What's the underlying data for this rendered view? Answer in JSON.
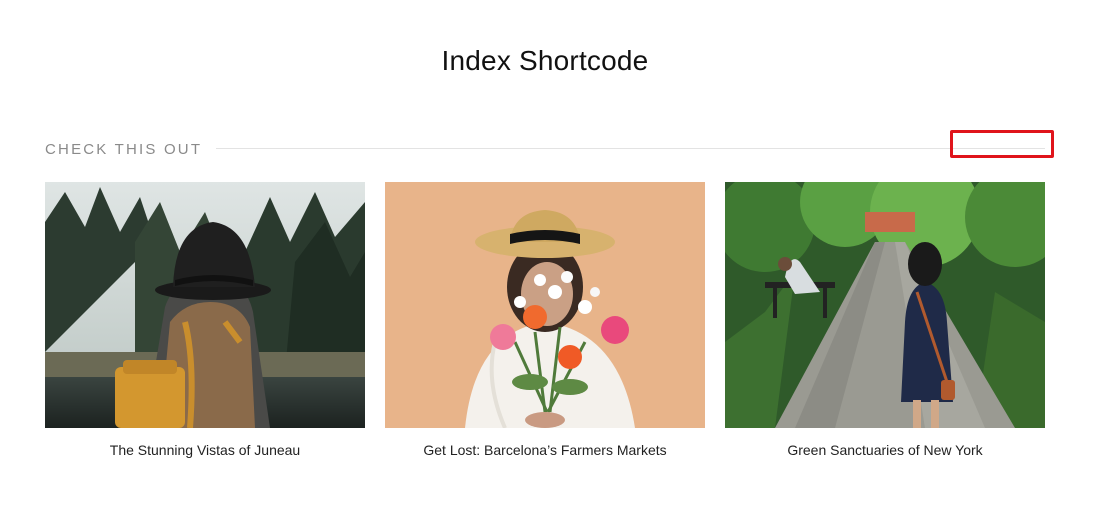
{
  "page": {
    "title": "Index Shortcode"
  },
  "section": {
    "label": "CHECK THIS OUT"
  },
  "posts": [
    {
      "title": "The Stunning Vistas of Juneau",
      "image": "woman-with-hat-forest-lake-photo"
    },
    {
      "title": "Get Lost: Barcelona’s Farmers Markets",
      "image": "woman-with-flower-bouquet-photo"
    },
    {
      "title": "Green Sanctuaries of New York",
      "image": "woman-in-park-path-photo"
    }
  ],
  "colors": {
    "highlight": "#e0141b",
    "section_label": "#8a8a8a",
    "rule": "#e3e3e3"
  }
}
